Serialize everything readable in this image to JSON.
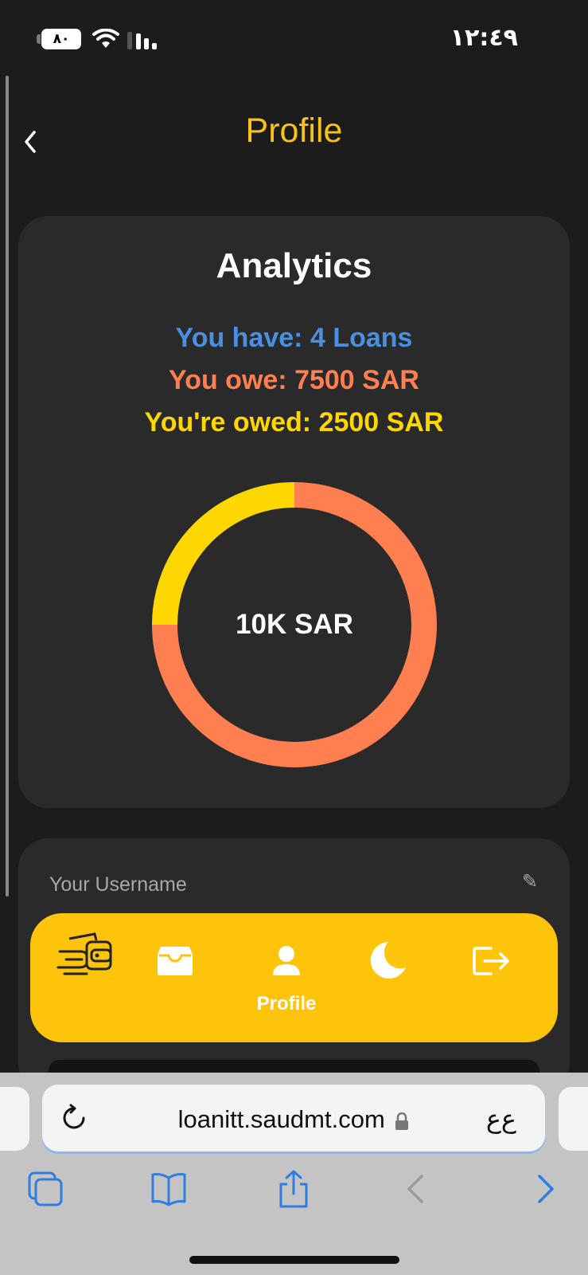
{
  "status_bar": {
    "battery_level": "٨٠",
    "time": "١٢:٤٩"
  },
  "header": {
    "title": "Profile"
  },
  "analytics": {
    "title": "Analytics",
    "loans_text": "You have: 4 Loans",
    "owe_text": "You owe: 7500 SAR",
    "owed_text": "You're owed: 2500 SAR",
    "total_label": "10K SAR",
    "colors": {
      "loans": "#4a90e2",
      "owe": "#ff7f50",
      "owed": "#ffd700"
    }
  },
  "chart_data": {
    "type": "pie",
    "categories": [
      "You owe",
      "You're owed"
    ],
    "values": [
      7500,
      2500
    ],
    "colors": [
      "#ff7f50",
      "#ffd700"
    ],
    "center_label": "10K SAR"
  },
  "profile": {
    "username_label": "Your Username"
  },
  "nav": {
    "items": [
      {
        "icon": "wallet-logo-icon"
      },
      {
        "icon": "inbox-icon"
      },
      {
        "icon": "user-icon",
        "label": "Profile"
      },
      {
        "icon": "moon-icon"
      },
      {
        "icon": "logout-icon"
      }
    ],
    "bg_color": "#fdc40b"
  },
  "browser": {
    "url": "loanitt.saudmt.com",
    "aa_label": "ع‌ع"
  }
}
